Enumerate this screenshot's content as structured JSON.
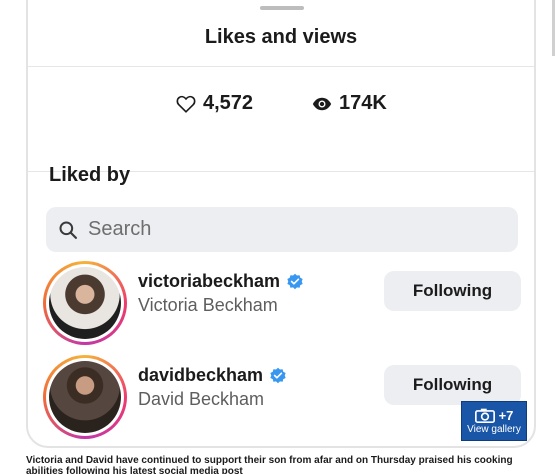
{
  "sheet": {
    "title": "Likes and views",
    "likes_count": "4,572",
    "views_count": "174K",
    "section_title": "Liked by"
  },
  "search": {
    "placeholder": "Search"
  },
  "users": [
    {
      "username": "victoriabeckham",
      "full_name": "Victoria Beckham",
      "button_label": "Following",
      "verified": true
    },
    {
      "username": "davidbeckham",
      "full_name": "David Beckham",
      "button_label": "Following",
      "verified": true
    }
  ],
  "gallery": {
    "count": "+7",
    "label": "View gallery"
  },
  "caption": "Victoria and David have continued to support their son from afar and on Thursday praised his cooking abilities following his latest social media post",
  "colors": {
    "verified": "#3897f0",
    "gallery_button": "#1a56a8",
    "button_bg": "#eceef2"
  },
  "icons": [
    "heart-icon",
    "eye-icon",
    "search-icon",
    "verified-badge-icon",
    "camera-icon"
  ]
}
